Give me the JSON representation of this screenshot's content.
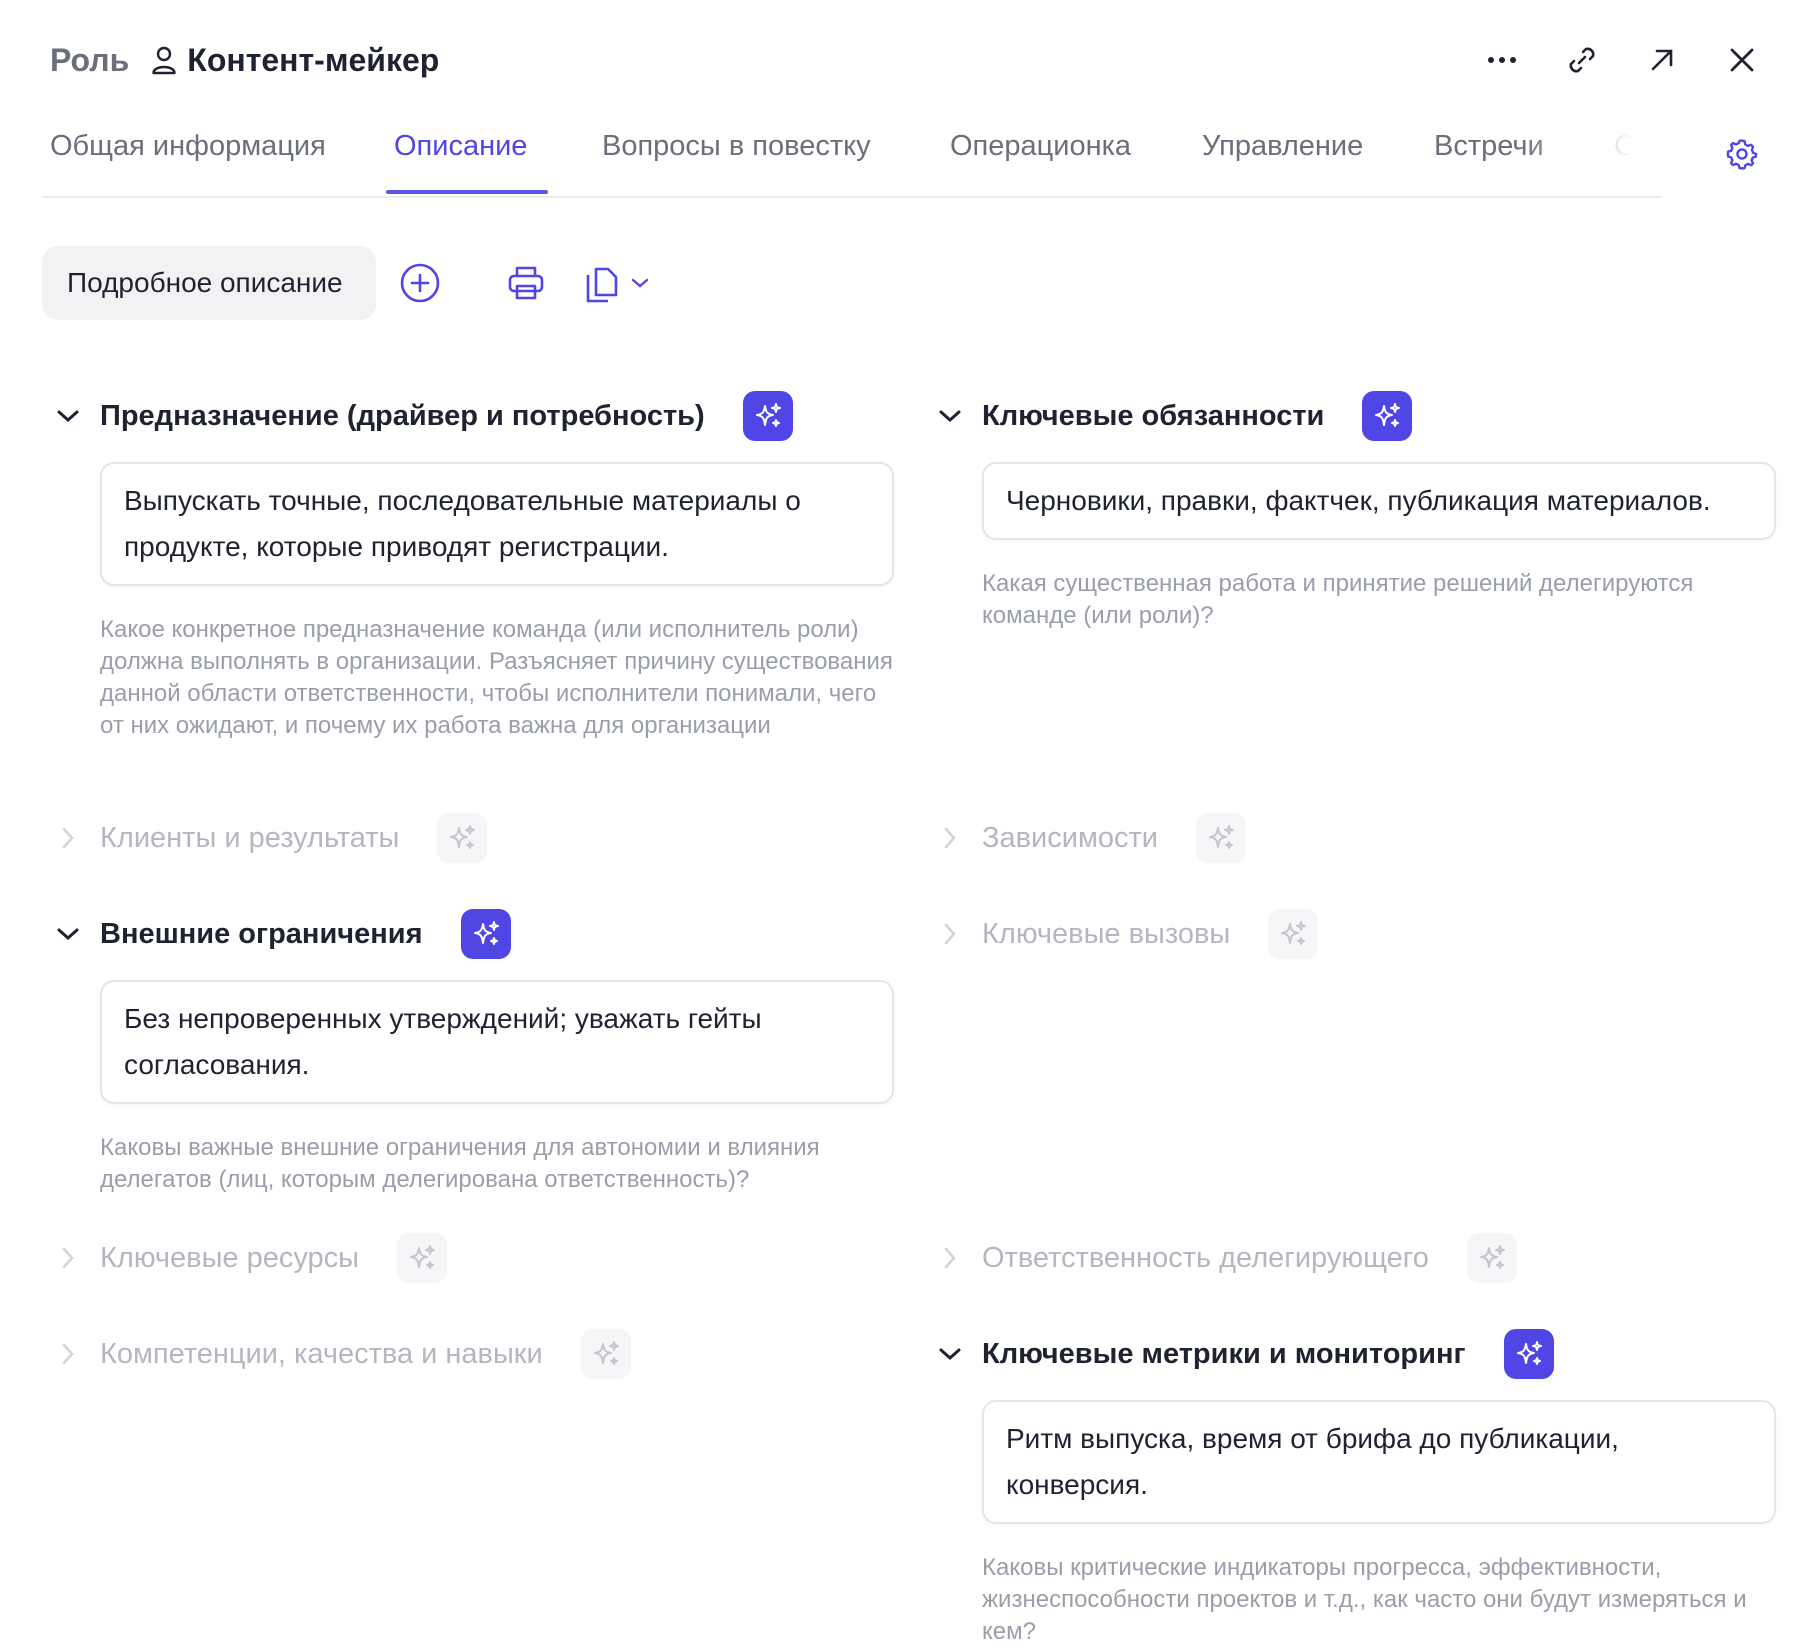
{
  "header": {
    "role_label": "Роль",
    "title": "Контент-мейкер",
    "icons": [
      "user-icon",
      "more-icon",
      "link-icon",
      "open-external-icon",
      "close-icon"
    ]
  },
  "tabs": [
    {
      "label": "Общая информация",
      "active": false
    },
    {
      "label": "Описание",
      "active": true
    },
    {
      "label": "Вопросы в повестку",
      "active": false
    },
    {
      "label": "Операционка",
      "active": false
    },
    {
      "label": "Управление",
      "active": false
    },
    {
      "label": "Встречи",
      "active": false
    },
    {
      "label": "Согласования",
      "active": false
    }
  ],
  "toolbar": {
    "chip_label": "Подробное описание",
    "icons": [
      "add-circle-icon",
      "print-icon",
      "copy-icon",
      "chevron-down-icon"
    ]
  },
  "colors": {
    "accent": "#4f46e5",
    "text": "#1f2230",
    "muted": "#6b6f7b",
    "hint": "#9a9ea9",
    "collapsed": "#b4b7c0"
  },
  "sections": {
    "purpose": {
      "title": "Предназначение (драйвер и потребность)",
      "expanded": true,
      "value": "Выпускать точные, последовательные материалы о продукте, которые приводят регистрации.",
      "hint": "Какое конкретное предназначение команда (или исполнитель роли) должна выполнять в организации. Разъясняет причину существования данной области ответственности, чтобы исполнители понимали, чего от них ожидают, и почему их работа важна для организации"
    },
    "duties": {
      "title": "Ключевые обязанности",
      "expanded": true,
      "value": "Черновики, правки, фактчек, публикация материалов.",
      "hint": "Какая существенная работа и принятие решений делегируются команде (или роли)?"
    },
    "clients": {
      "title": "Клиенты и результаты",
      "expanded": false
    },
    "dependencies": {
      "title": "Зависимости",
      "expanded": false
    },
    "constraints": {
      "title": "Внешние ограничения",
      "expanded": true,
      "value": "Без непроверенных утверждений; уважать гейты согласования.",
      "hint": "Каковы важные внешние ограничения для автономии и влияния делегатов (лиц, которым делегирована ответственность)?"
    },
    "challenges": {
      "title": "Ключевые вызовы",
      "expanded": false
    },
    "resources": {
      "title": "Ключевые ресурсы",
      "expanded": false
    },
    "delegator": {
      "title": "Ответственность делегирующего",
      "expanded": false
    },
    "competencies": {
      "title": "Компетенции, качества и навыки",
      "expanded": false
    },
    "metrics": {
      "title": "Ключевые метрики и мониторинг",
      "expanded": true,
      "value": "Ритм выпуска, время от брифа до публикации, конверсия.",
      "hint": "Каковы критические индикаторы прогресса, эффективности, жизнеспособности проектов и т.д., как часто они будут измеряться и кем?"
    }
  }
}
